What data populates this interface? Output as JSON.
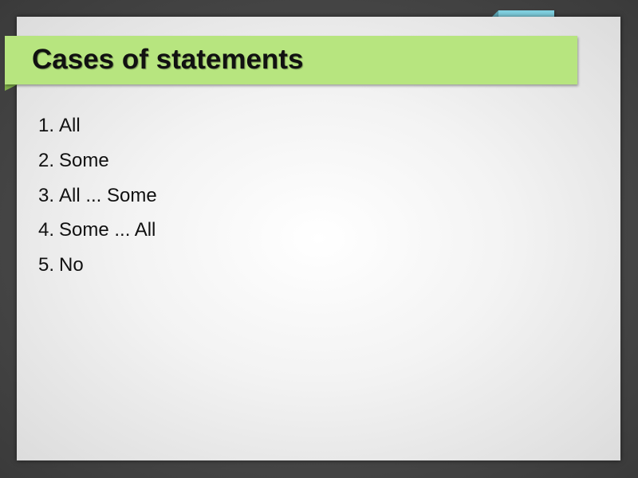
{
  "slide": {
    "title": "Cases of statements",
    "items": [
      {
        "number": "1.",
        "text": "All"
      },
      {
        "number": "2.",
        "text": "Some"
      },
      {
        "number": "3.",
        "text": "All ... Some"
      },
      {
        "number": "4.",
        "text": "Some ... All"
      },
      {
        "number": "5.",
        "text": "No"
      }
    ]
  },
  "colors": {
    "title_bar": "#b7e57f",
    "accent_tab": "#80d0e0",
    "background": "#4a4a4a",
    "slide": "#f3f3f3"
  }
}
